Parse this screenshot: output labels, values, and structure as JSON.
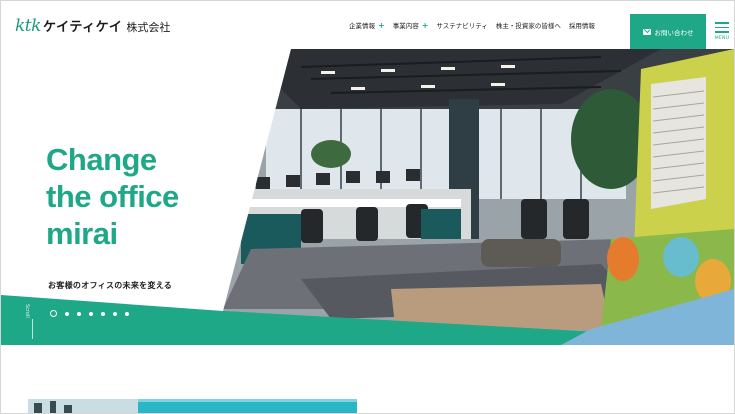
{
  "header": {
    "logo_mark": "ktk",
    "logo_kana": "ケイティケイ",
    "logo_corp": "株式会社",
    "nav": [
      {
        "label": "企業情報",
        "has_plus": true
      },
      {
        "label": "事業内容",
        "has_plus": true
      },
      {
        "label": "サステナビリティ",
        "has_plus": false
      },
      {
        "label": "株主・投資家の皆様へ",
        "has_plus": false
      },
      {
        "label": "採用情報",
        "has_plus": false
      }
    ],
    "contact_label": "お問い合わせ",
    "menu_label": "MENU"
  },
  "hero": {
    "headline_line1": "Change",
    "headline_line2": "the office",
    "headline_line3": "mirai",
    "tagline": "お客様のオフィスの未来を変える",
    "scroll_label": "Scroll",
    "slide_count": 7,
    "active_slide": 1
  },
  "colors": {
    "brand": "#1fa887",
    "logo": "#1b9b82",
    "text": "#1a1a1a"
  },
  "icons": {
    "contact": "mail-icon",
    "menu": "hamburger-icon"
  }
}
